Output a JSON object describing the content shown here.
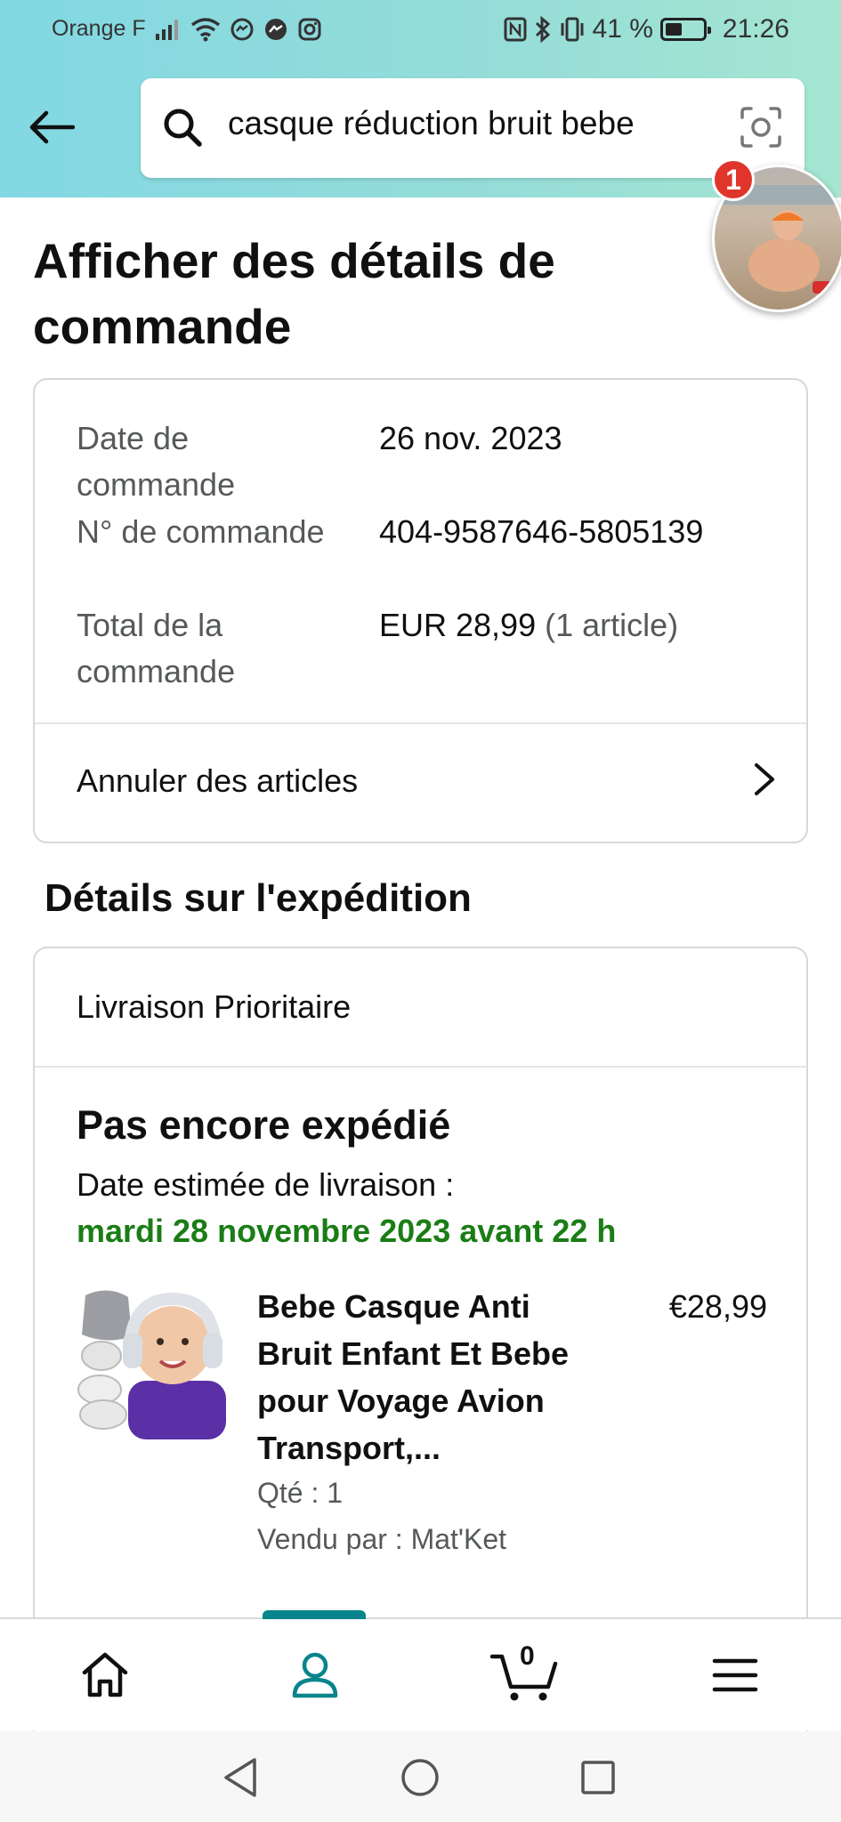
{
  "status_bar": {
    "carrier": "Orange F",
    "battery": "41 %",
    "time": "21:26"
  },
  "search": {
    "query": "casque réduction bruit bebe"
  },
  "notifications": {
    "badge_count": "1"
  },
  "page": {
    "title": "Afficher des détails de commande"
  },
  "order_summary": {
    "rows": [
      {
        "label": "Date de commande",
        "value": "26 nov. 2023"
      },
      {
        "label": "N° de commande",
        "value": "404-9587646-5805139"
      },
      {
        "label": "Total de la commande",
        "value": "EUR 28,99",
        "extra": "(1 article)"
      }
    ],
    "cancel_label": "Annuler des articles"
  },
  "shipment": {
    "section_title": "Détails sur l'expédition",
    "method": "Livraison Prioritaire",
    "status": "Pas encore expédié",
    "estimate_label": "Date estimée de livraison :",
    "estimate_date": "mardi 28 novembre 2023 avant 22 h",
    "status_color": "#1a7d15"
  },
  "product": {
    "title": "Bebe Casque Anti Bruit Enfant Et Bebe pour Voyage Avion Transport,...",
    "price": "€28,99",
    "quantity": "Qté : 1",
    "seller": "Vendu par : Mat'Ket"
  },
  "bottom_nav": {
    "items": [
      {
        "icon": "home-icon"
      },
      {
        "icon": "account-icon",
        "active": true
      },
      {
        "icon": "cart-icon",
        "count": "0"
      },
      {
        "icon": "menu-icon"
      }
    ],
    "accent": "#08848c"
  }
}
